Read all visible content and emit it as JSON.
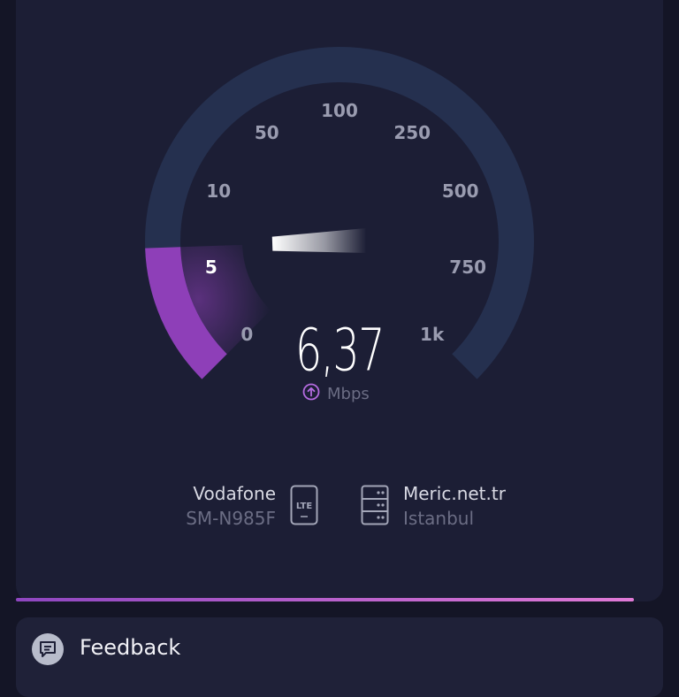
{
  "gauge": {
    "scale_labels": [
      "0",
      "5",
      "10",
      "50",
      "100",
      "250",
      "500",
      "750",
      "1k"
    ],
    "active_label": "5",
    "colors": {
      "track": "#25304f",
      "fill": "#8e3fb8",
      "needle": "#ffffff"
    }
  },
  "reading": {
    "speed": "6,37",
    "unit": "Mbps",
    "direction_icon": "upload-arrow-icon"
  },
  "provider": {
    "name": "Vodafone",
    "device": "SM-N985F",
    "network_badge": "LTE",
    "icon": "phone-lte-icon"
  },
  "server": {
    "name": "Meric.net.tr",
    "location": "Istanbul",
    "icon": "server-icon"
  },
  "progress": {
    "fraction": 0.955
  },
  "feedback": {
    "label": "Feedback",
    "icon": "chat-bubble-icon"
  }
}
